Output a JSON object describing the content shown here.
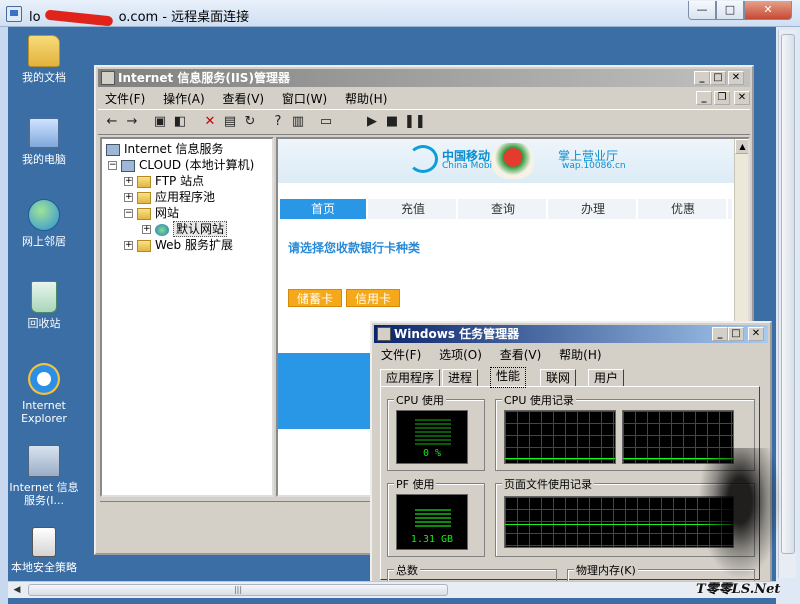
{
  "rdp": {
    "title_prefix": "lo",
    "title_host_suffix": "o.com",
    "title_suffix": " - 远程桌面连接",
    "btn_min": "—",
    "btn_max": "□",
    "btn_close": "✕"
  },
  "desktop": {
    "icons": [
      {
        "label": "我的文档",
        "icon": "folder-icon"
      },
      {
        "label": "我的电脑",
        "icon": "computer-icon"
      },
      {
        "label": "网上邻居",
        "icon": "network-icon"
      },
      {
        "label": "回收站",
        "icon": "recycle-bin-icon"
      },
      {
        "label": "Internet Explorer",
        "icon": "ie-icon"
      },
      {
        "label": "Internet 信息服务(I...",
        "icon": "iis-shortcut-icon"
      },
      {
        "label": "本地安全策略",
        "icon": "security-policy-icon"
      }
    ]
  },
  "iis": {
    "title": "Internet 信息服务(IIS)管理器",
    "menu": [
      "文件(F)",
      "操作(A)",
      "查看(V)",
      "窗口(W)",
      "帮助(H)"
    ],
    "tree": {
      "root": "Internet 信息服务",
      "computer": "CLOUD (本地计算机)",
      "ftp": "FTP 站点",
      "pools": "应用程序池",
      "websites": "网站",
      "default_site": "默认网站",
      "web_ext": "Web 服务扩展"
    }
  },
  "browser": {
    "brand": "中国移动",
    "brand_en": "China Mobile",
    "hall": "掌上营业厅",
    "url": "wap.10086.cn",
    "nav": [
      "首页",
      "充值",
      "查询",
      "办理",
      "优惠"
    ],
    "prompt": "请选择您收款银行卡种类",
    "btn_debit": "储蓄卡",
    "btn_credit": "信用卡"
  },
  "taskmgr": {
    "title": "Windows 任务管理器",
    "menu": [
      "文件(F)",
      "选项(O)",
      "查看(V)",
      "帮助(H)"
    ],
    "tabs": [
      "应用程序",
      "进程",
      "性能",
      "联网",
      "用户"
    ],
    "cpu_usage_label": "CPU 使用",
    "cpu_usage_value": "0 %",
    "cpu_history_label": "CPU 使用记录",
    "pf_usage_label": "PF 使用",
    "pf_usage_value": "1.31 GB",
    "pf_history_label": "页面文件使用记录",
    "totals_label": "总数",
    "physical_mem_label": "物理内存(K)"
  },
  "watermark": "T零零LS.Net",
  "colors": {
    "desktop_bg": "#3a6ea5",
    "title_active": "#0a246a",
    "cm_blue": "#2a96e6",
    "cm_orange": "#f4a81a",
    "meter_green": "#19e819"
  }
}
